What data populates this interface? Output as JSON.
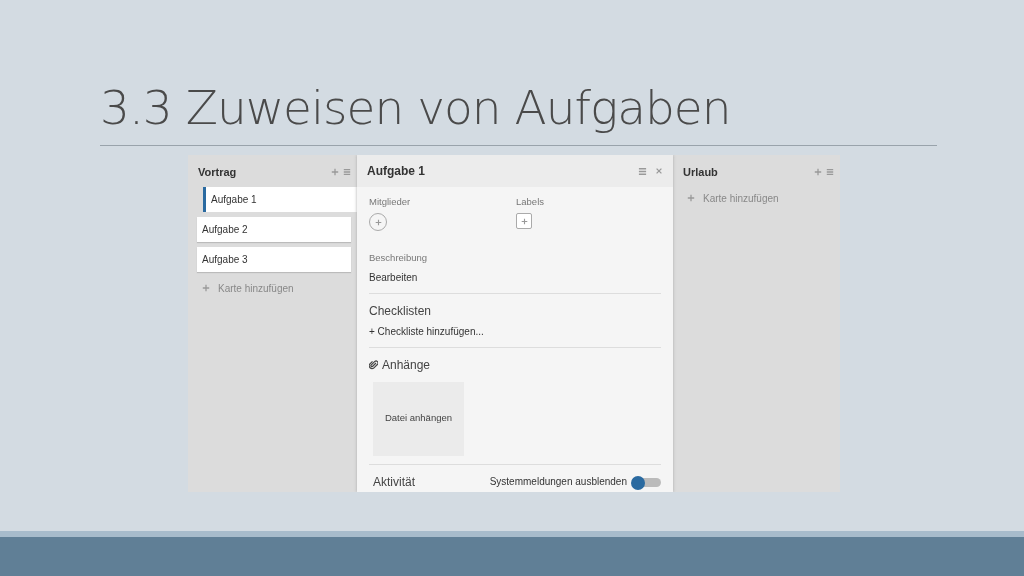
{
  "slide_title": "3.3 Zuweisen von Aufgaben",
  "lists": [
    {
      "title": "Vortrag",
      "cards": [
        {
          "title": "Aufgabe 1",
          "selected": true
        },
        {
          "title": "Aufgabe 2",
          "selected": false
        },
        {
          "title": "Aufgabe 3",
          "selected": false
        }
      ],
      "add_card": "Karte hinzufügen"
    }
  ],
  "card_detail": {
    "title": "Aufgabe 1",
    "members_label": "Mitglieder",
    "labels_label": "Labels",
    "description_label": "Beschreibung",
    "description_action": "Bearbeiten",
    "checklists_title": "Checklisten",
    "add_checklist": "+ Checkliste hinzufügen...",
    "attachments_title": "Anhänge",
    "attach_file": "Datei anhängen",
    "activity_title": "Aktivität",
    "hide_system_messages": {
      "label": "Systemmeldungen ausblenden",
      "on": true
    }
  },
  "right_lists": [
    {
      "title": "Urlaub",
      "add_card": "Karte hinzufügen"
    }
  ]
}
